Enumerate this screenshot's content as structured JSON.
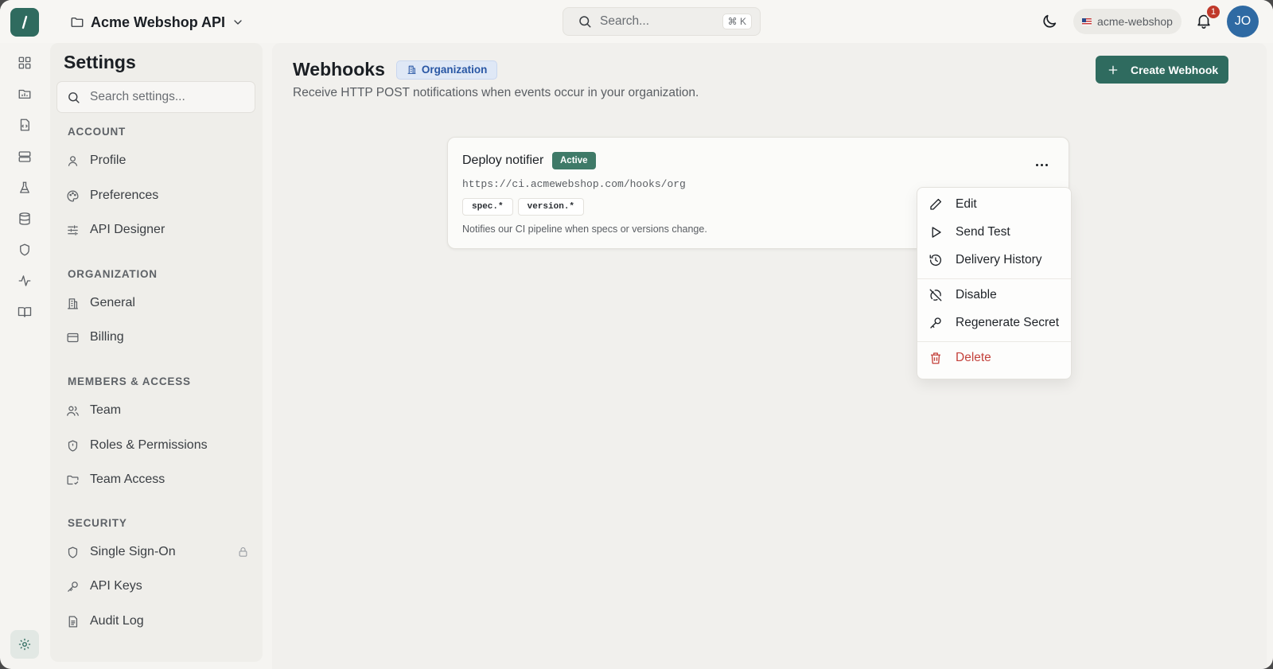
{
  "topbar": {
    "project_name": "Acme Webshop API",
    "search_placeholder": "Search...",
    "search_shortcut": "⌘ K",
    "org_chip": "acme-webshop",
    "notification_count": "1",
    "avatar_initials": "JO"
  },
  "rail": {
    "icons": [
      "dashboard-icon",
      "projects-icon",
      "api-icon",
      "servers-icon",
      "test-flask-icon",
      "database-icon",
      "shield-icon",
      "activity-icon",
      "docs-book-icon",
      "settings-gear-icon"
    ]
  },
  "settings": {
    "title": "Settings",
    "search_placeholder": "Search settings...",
    "sections": {
      "account": {
        "title": "ACCOUNT",
        "items": [
          "Profile",
          "Preferences",
          "API Designer"
        ]
      },
      "organization": {
        "title": "ORGANIZATION",
        "items": [
          "General",
          "Billing"
        ]
      },
      "members": {
        "title": "MEMBERS & ACCESS",
        "items": [
          "Team",
          "Roles & Permissions",
          "Team Access"
        ]
      },
      "security": {
        "title": "SECURITY",
        "items": [
          "Single Sign-On",
          "API Keys",
          "Audit Log"
        ]
      }
    }
  },
  "main": {
    "title": "Webhooks",
    "scope_badge": "Organization",
    "subtitle": "Receive HTTP POST notifications when events occur in your organization.",
    "create_button": "Create Webhook",
    "webhook": {
      "name": "Deploy notifier",
      "status": "Active",
      "url": "https://ci.acmewebshop.com/hooks/org",
      "events": [
        "spec.*",
        "version.*"
      ],
      "description": "Notifies our CI pipeline when specs or versions change."
    },
    "menu": {
      "edit": "Edit",
      "send_test": "Send Test",
      "delivery_history": "Delivery History",
      "disable": "Disable",
      "regenerate_secret": "Regenerate Secret",
      "delete": "Delete"
    }
  },
  "colors": {
    "brand": "#2f6b5f",
    "status_active": "#3f7a68",
    "danger": "#c4423c",
    "badge_blue": "#2957a4",
    "avatar": "#2f6aa3"
  }
}
